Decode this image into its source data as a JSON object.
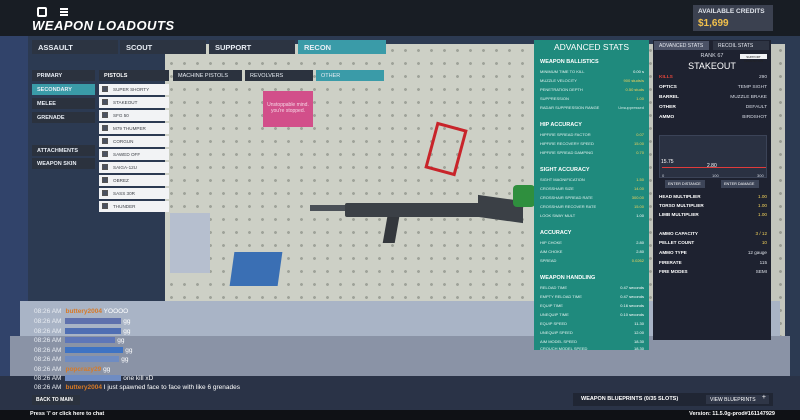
{
  "header": {
    "title": "WEAPON LOADOUTS",
    "credits_label": "AVAILABLE CREDITS",
    "credits_value": "$1,699"
  },
  "categories": [
    {
      "label": "ASSAULT",
      "active": false
    },
    {
      "label": "SCOUT",
      "active": false
    },
    {
      "label": "SUPPORT",
      "active": false
    },
    {
      "label": "RECON",
      "active": true
    }
  ],
  "slots": [
    {
      "label": "PRIMARY",
      "active": false
    },
    {
      "label": "SECONDARY",
      "active": true
    },
    {
      "label": "MELEE",
      "active": false
    },
    {
      "label": "GRENADE",
      "active": false
    }
  ],
  "extras": [
    "ATTACHMENTS",
    "WEAPON SKIN"
  ],
  "weapon_class": "PISTOLS",
  "weapons": [
    "SUPER SHORTY",
    "STAKEOUT",
    "SFG 50",
    "M79 THUMPER",
    "CORGUN",
    "SAWED OFF",
    "SAIGA-12U",
    "OBREZ",
    "SASS 30R",
    "THUNDER"
  ],
  "subcategories": [
    {
      "label": "MACHINE PISTOLS",
      "active": false
    },
    {
      "label": "REVOLVERS",
      "active": false
    },
    {
      "label": "OTHER",
      "active": true
    }
  ],
  "advanced": {
    "title": "ADVANCED STATS",
    "sections": [
      {
        "heading": "WEAPON BALLISTICS",
        "rows": [
          [
            "MINIMUM TIME TO KILL",
            "0.00 s"
          ],
          [
            "MUZZLE VELOCITY",
            "900 studs/s"
          ],
          [
            "PENETRATION DEPTH",
            "0.50 studs"
          ],
          [
            "SUPPRESSION",
            "1.00"
          ],
          [
            "RADAR SUPPRESSION RANGE",
            "Unsuppressed"
          ]
        ]
      },
      {
        "heading": "HIP ACCURACY",
        "rows": [
          [
            "HIPFIRE SPREAD FACTOR",
            "0.07"
          ],
          [
            "HIPFIRE RECOVERY SPEED",
            "15.00"
          ],
          [
            "HIPFIRE SPREAD DAMPING",
            "0.70"
          ]
        ]
      },
      {
        "heading": "SIGHT ACCURACY",
        "rows": [
          [
            "SIGHT MAGNIFICATION",
            "1.50"
          ],
          [
            "CROSSHAIR SIZE",
            "14.00"
          ],
          [
            "CROSSHAIR SPREAD RATE",
            "300.00"
          ],
          [
            "CROSSHAIR RECOVER RATE",
            "15.00"
          ],
          [
            "LOOK SWAY MULT",
            "1.00"
          ]
        ]
      },
      {
        "heading": "ACCURACY",
        "rows": [
          [
            "HIP CHOKE",
            "2.80"
          ],
          [
            "AIM CHOKE",
            "2.80"
          ],
          [
            "SPREAD",
            "0.0262"
          ]
        ]
      },
      {
        "heading": "WEAPON HANDLING",
        "rows": [
          [
            "RELOAD TIME",
            "0.47 seconds"
          ],
          [
            "EMPTY RELOAD TIME",
            "0.47 seconds"
          ],
          [
            "EQUIP TIME",
            "0.16 seconds"
          ],
          [
            "UNEQUIP TIME",
            "0.10 seconds"
          ],
          [
            "EQUIP SPEED",
            "11.30"
          ],
          [
            "UNEQUIP SPEED",
            "12.00"
          ],
          [
            "AIM MODEL SPEED",
            "18.30"
          ],
          [
            "CROUCH MODEL SPEED",
            "18.30"
          ]
        ]
      }
    ]
  },
  "right_panel": {
    "tabs": [
      {
        "label": "ADVANCED STATS",
        "active": true
      },
      {
        "label": "RECOIL STATS",
        "active": false
      }
    ],
    "rank": "RANK 67",
    "name": "STAKEOUT",
    "badge": "SUPPORT AMMUNITION",
    "kills": [
      "KILLS",
      "290"
    ],
    "attachments": [
      [
        "OPTICS",
        "TEMP SIGHT"
      ],
      [
        "BARREL",
        "MUZZLE BRAKE"
      ],
      [
        "OTHER",
        "DEFAULT"
      ],
      [
        "AMMO",
        "BIRDSHOT"
      ]
    ],
    "graph": {
      "near": "15.75",
      "far": "2.80",
      "x0": "0",
      "x100": "100",
      "x300": "300"
    },
    "graph_buttons": [
      "ENTER DISTANCE",
      "ENTER DAMAGE"
    ],
    "multipliers": [
      [
        "HEAD MULTIPLIER",
        "1.00"
      ],
      [
        "TORSO MULTIPLIER",
        "1.00"
      ],
      [
        "LIMB MULTIPLIER",
        "1.00"
      ]
    ],
    "ammo": [
      [
        "AMMO CAPACITY",
        "3 / 12"
      ],
      [
        "PELLET COUNT",
        "10"
      ],
      [
        "AMMO TYPE",
        "12 gauge"
      ],
      [
        "FIRERATE",
        "115"
      ],
      [
        "FIRE MODES",
        "SEMI"
      ]
    ]
  },
  "chat": [
    {
      "time": "08:26 AM",
      "user": "buttery2004",
      "color": "#d77a27",
      "msg": "YOOOO"
    },
    {
      "time": "08:26 AM",
      "user": "",
      "color": "#7a8cc8",
      "msg": "gg"
    },
    {
      "time": "08:26 AM",
      "user": "",
      "color": "#6f8cc2",
      "msg": "gg"
    },
    {
      "time": "08:26 AM",
      "user": "",
      "color": "#6f8cc2",
      "msg": "gg"
    },
    {
      "time": "08:26 AM",
      "user": "",
      "color": "#3e73c4",
      "msg": "gg"
    },
    {
      "time": "08:26 AM",
      "user": "",
      "color": "#6f8cc2",
      "msg": "gg"
    },
    {
      "time": "08:26 AM",
      "user": "popcrazy29",
      "color": "#d77a27",
      "msg": "gg"
    },
    {
      "time": "08:26 AM",
      "user": "",
      "color": "#6f8cc2",
      "msg": "one kill xD"
    },
    {
      "time": "08:26 AM",
      "user": "buttery2004",
      "color": "#d77a27",
      "msg": "I just spawned face to face with like 6 grenades"
    }
  ],
  "back_button": "BACK TO MAIN",
  "blueprints": {
    "label": "WEAPON BLUEPRINTS (0/35 SLOTS)",
    "button": "VIEW BLUEPRINTS"
  },
  "footer": {
    "hint": "Press '/' or click here to chat",
    "version": "Version: 11.5.0g-prod#161147929"
  },
  "poster_text": "Unstoppable mind. you're stopped.",
  "colors": {
    "accent": "#3a9ba8",
    "stats_panel": "#1f8a7d",
    "credits": "#f2c14c",
    "value": "#f3d35b"
  }
}
